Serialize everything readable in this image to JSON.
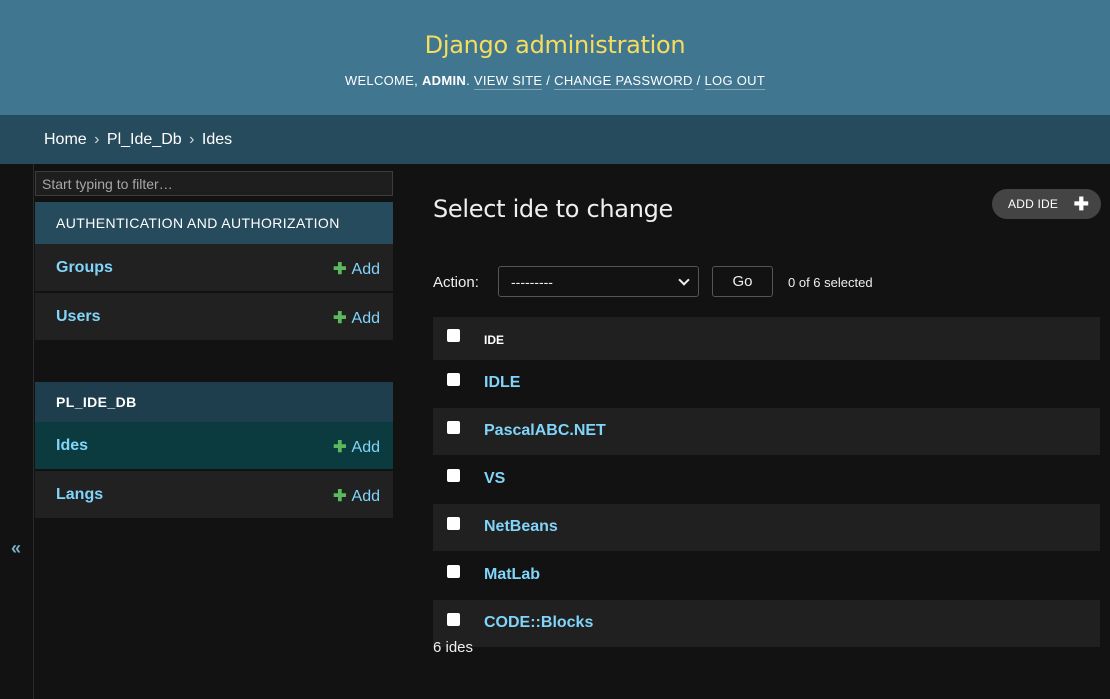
{
  "header": {
    "site_title": "Django administration",
    "welcome": "Welcome,",
    "username": "admin",
    "links": [
      "View site",
      "Change password",
      "Log out"
    ],
    "separator": "/"
  },
  "breadcrumbs": {
    "items": [
      "Home",
      "Pl_Ide_Db",
      "Ides"
    ],
    "separator": "›"
  },
  "sidebar": {
    "filter_placeholder": "Start typing to filter…",
    "apps": [
      {
        "caption": "Authentication and Authorization",
        "models": [
          {
            "name": "Groups",
            "add": "Add"
          },
          {
            "name": "Users",
            "add": "Add"
          }
        ]
      },
      {
        "caption": "PL_IDE_DB",
        "models": [
          {
            "name": "Ides",
            "add": "Add",
            "current": true
          },
          {
            "name": "Langs",
            "add": "Add"
          }
        ]
      }
    ],
    "toggle_icon": "«"
  },
  "content": {
    "title": "Select ide to change",
    "add_button": "Add IDE",
    "action_label": "Action:",
    "action_selected": "---------",
    "go_label": "Go",
    "selection_count": "0 of 6 selected",
    "column_header": "IDE",
    "rows": [
      "IDLE",
      "PascalABC.NET",
      "VS",
      "NetBeans",
      "MatLab",
      "CODE::Blocks"
    ],
    "paginator": "6 ides"
  },
  "colors": {
    "header_bg": "#417690",
    "breadcrumbs_bg": "#264b5d",
    "site_title": "#f5dd5d",
    "link": "#81d4fa",
    "add_plus": "#5cb85c",
    "current_row": "#0b3b3f"
  }
}
